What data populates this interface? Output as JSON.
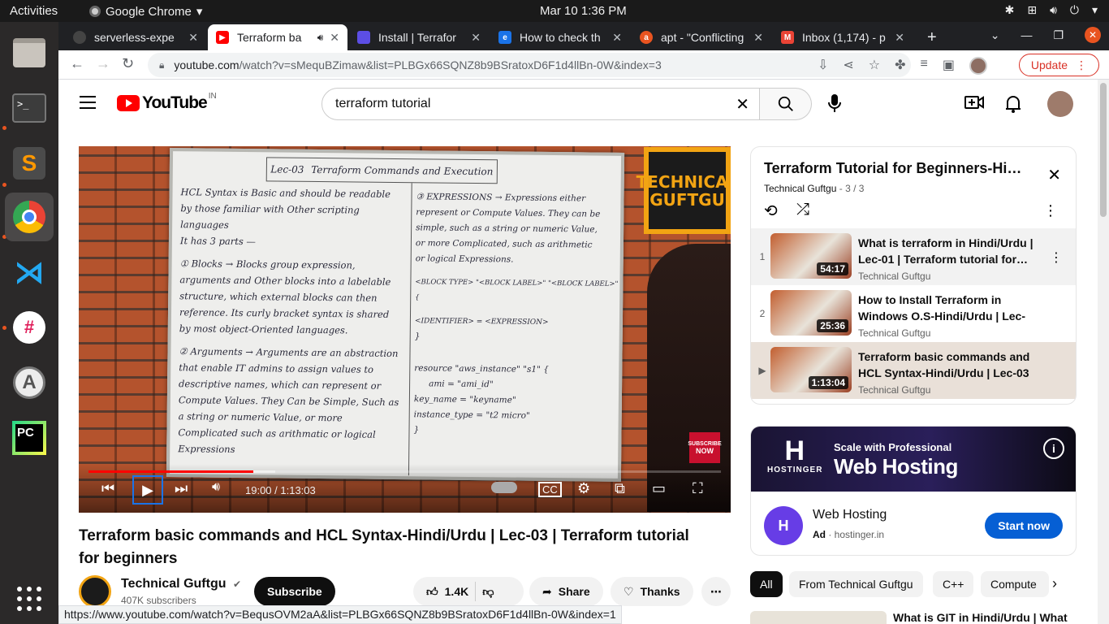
{
  "system": {
    "activities": "Activities",
    "app_menu": "Google Chrome",
    "clock": "Mar 10  1:36 PM"
  },
  "dock": {
    "apps": [
      "Files",
      "Terminal",
      "Sublime Text",
      "Google Chrome",
      "Visual Studio Code",
      "Slack",
      "Ubuntu Software",
      "PyCharm",
      "Show Applications"
    ]
  },
  "tabs": [
    {
      "label": "serverless-expe",
      "color": "#202124"
    },
    {
      "label": "Terraform ba",
      "color": "#ff0000"
    },
    {
      "label": "Install | Terrafor",
      "color": "#5c4ee5"
    },
    {
      "label": "How to check th",
      "color": "#1a73e8"
    },
    {
      "label": "apt - \"Conflicting",
      "color": "#e95420"
    },
    {
      "label": "Inbox (1,174) - p",
      "color": "#ea4335"
    }
  ],
  "omnibox": {
    "host": "youtube.com",
    "path": "/watch?v=sMequBZimaw&list=PLBGx66SQNZ8b9BSratoxD6F1d4llBn-0W&index=3"
  },
  "update_label": "Update",
  "youtube": {
    "logo_text": "YouTube",
    "region": "IN",
    "search_value": "terraform tutorial"
  },
  "player": {
    "time": "19:00 / 1:13:03",
    "played_fraction": 0.26,
    "buffered_fraction": 0.295,
    "board_header_left": "Lec-03",
    "board_header_right": "Terraform Commands and Execution",
    "board_left": [
      "HCL Syntax is Basic and should be readable",
      "by those familiar with Other scripting languages",
      "It has 3 parts —",
      "① Blocks → Blocks group expression,",
      "arguments and Other blocks into a labelable",
      "structure, which external blocks can then",
      "reference. Its curly bracket syntax is shared",
      "by most object-Oriented languages.",
      "② Arguments → Arguments are an abstraction",
      "that enable IT admins to assign values to",
      "descriptive names, which can represent or",
      "Compute Values. They Can be Simple, Such as",
      "a string or numeric Value, or more",
      "Complicated such as arithmatic or logical Expressions"
    ],
    "board_right": [
      "③ EXPRESSIONS → Expressions either",
      "represent or Compute Values. They can be",
      "simple, such as a string or numeric Value,",
      "or more Complicated, such as arithmetic",
      "or logical Expressions.",
      "",
      "<BLOCK TYPE> \"<BLOCK LABEL>\" \"<BLOCK LABEL>\" {",
      "",
      "<IDENTIFIER> = <EXPRESSION>",
      "}",
      "",
      "resource \"aws_instance\" \"s1\" {",
      "ami = \"ami_id\"",
      "key_name = \"keyname\"",
      "instance_type = \"t2 micro\"",
      "}"
    ],
    "logo_line1": "TECHNICAL",
    "logo_line2": "GUFTGU",
    "subscribe_badge_1": "SUBSCRIBE",
    "subscribe_badge_2": "NOW"
  },
  "video": {
    "title": "Terraform basic commands and HCL Syntax-Hindi/Urdu | Lec-03 | Terraform tutorial for beginners",
    "channel": "Technical Guftgu",
    "subscribers": "407K subscribers",
    "subscribe_label": "Subscribe",
    "likes": "1.4K",
    "share_label": "Share",
    "thanks_label": "Thanks"
  },
  "playlist": {
    "title": "Terraform Tutorial for Beginners-Hi…",
    "channel": "Technical Guftgu",
    "count": "- 3 / 3",
    "items": [
      {
        "index": "1",
        "title": "What is terraform in Hindi/Urdu | Lec-01 | Terraform tutorial for…",
        "channel": "Technical Guftgu",
        "duration": "54:17"
      },
      {
        "index": "2",
        "title": "How to Install Terraform in Windows O.S-Hindi/Urdu | Lec-0…",
        "channel": "Technical Guftgu",
        "duration": "25:36"
      },
      {
        "index": "▶",
        "title": "Terraform basic commands and HCL Syntax-Hindi/Urdu | Lec-03 …",
        "channel": "Technical Guftgu",
        "duration": "1:13:04"
      }
    ]
  },
  "ad": {
    "brand": "HOSTINGER",
    "tagline_small": "Scale with Professional",
    "tagline_big": "Web Hosting",
    "title": "Web Hosting",
    "ad_label": "Ad",
    "domain": "· hostinger.in",
    "cta": "Start now"
  },
  "chips": [
    "All",
    "From Technical Guftgu",
    "C++",
    "Compute"
  ],
  "next_rec_title": "What is GIT in Hindi/Urdu | What",
  "status_url": "https://www.youtube.com/watch?v=BequsOVM2aA&list=PLBGx66SQNZ8b9BSratoxD6F1d4llBn-0W&index=1"
}
